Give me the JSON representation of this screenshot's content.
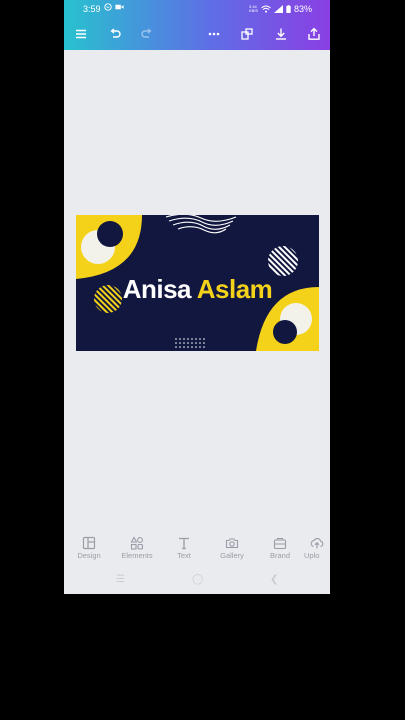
{
  "status_bar": {
    "time": "3:59",
    "speed": "3.44 KB/S",
    "battery": "83%"
  },
  "toolbar": {
    "icons": [
      "menu-icon",
      "undo-icon",
      "redo-icon",
      "more-icon",
      "resize-icon",
      "download-icon",
      "share-icon"
    ]
  },
  "canvas": {
    "name_first": "Anisa",
    "name_last": "Aslam",
    "colors": {
      "background": "#11173f",
      "accent": "#f5d21a",
      "light": "#f2f2ea",
      "text": "#ffffff"
    }
  },
  "bottom_tabs": [
    {
      "label": "Design"
    },
    {
      "label": "Elements"
    },
    {
      "label": "Text"
    },
    {
      "label": "Gallery"
    },
    {
      "label": "Brand"
    },
    {
      "label": "Uplo"
    }
  ]
}
